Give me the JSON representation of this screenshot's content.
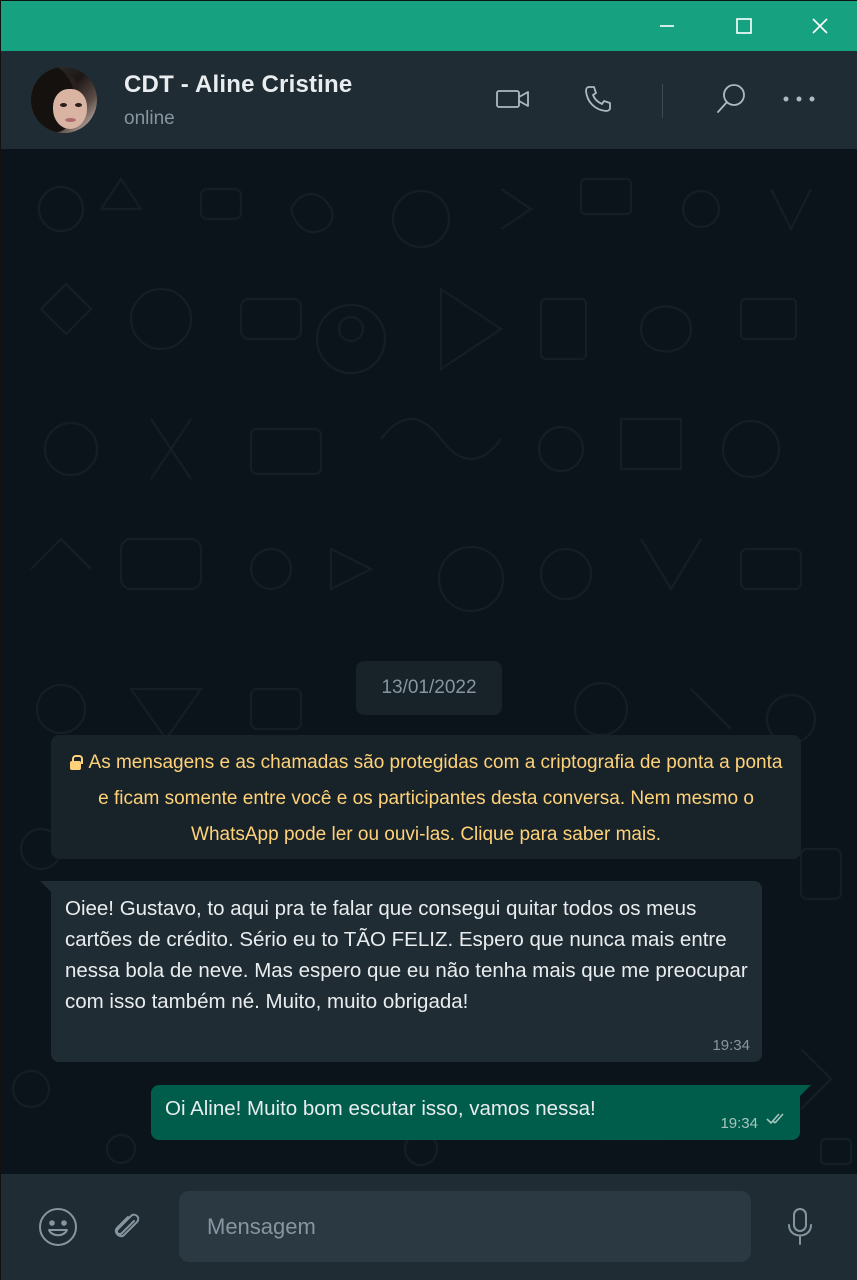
{
  "window": {
    "controls": [
      "minimize-icon",
      "maximize-icon",
      "close-icon"
    ],
    "accent": "#16a281"
  },
  "header": {
    "contact_name": "CDT - Aline Cristine",
    "status": "online",
    "icons": [
      "video-call-icon",
      "voice-call-icon",
      "search-icon",
      "more-options-icon"
    ]
  },
  "chat": {
    "date": "13/01/2022",
    "encryption_notice": "As mensagens e as chamadas são protegidas com a criptografia de ponta a ponta e ficam somente entre você e os participantes desta conversa. Nem mesmo o WhatsApp pode ler ou ouvi-las. Clique para saber mais.",
    "messages": [
      {
        "direction": "incoming",
        "text": "Oiee! Gustavo, to aqui pra te falar que consegui quitar todos os meus cartões de crédito. Sério eu to TÃO FELIZ. Espero que nunca mais entre nessa bola de neve. Mas espero que eu não tenha mais que me preocupar com isso também né. Muito, muito obrigada!",
        "time": "19:34"
      },
      {
        "direction": "outgoing",
        "text": "Oi Aline! Muito bom escutar isso, vamos nessa!",
        "time": "19:34",
        "status_icon": "double-check-icon"
      }
    ]
  },
  "footer": {
    "input_placeholder": "Mensagem",
    "icons": [
      "emoji-icon",
      "attach-icon",
      "microphone-icon"
    ]
  },
  "colors": {
    "chat_bg": "#0b141a",
    "header_bg": "#202c33",
    "incoming_bubble": "#202c33",
    "outgoing_bubble": "#005c4b",
    "notice_text": "#ffd279"
  }
}
